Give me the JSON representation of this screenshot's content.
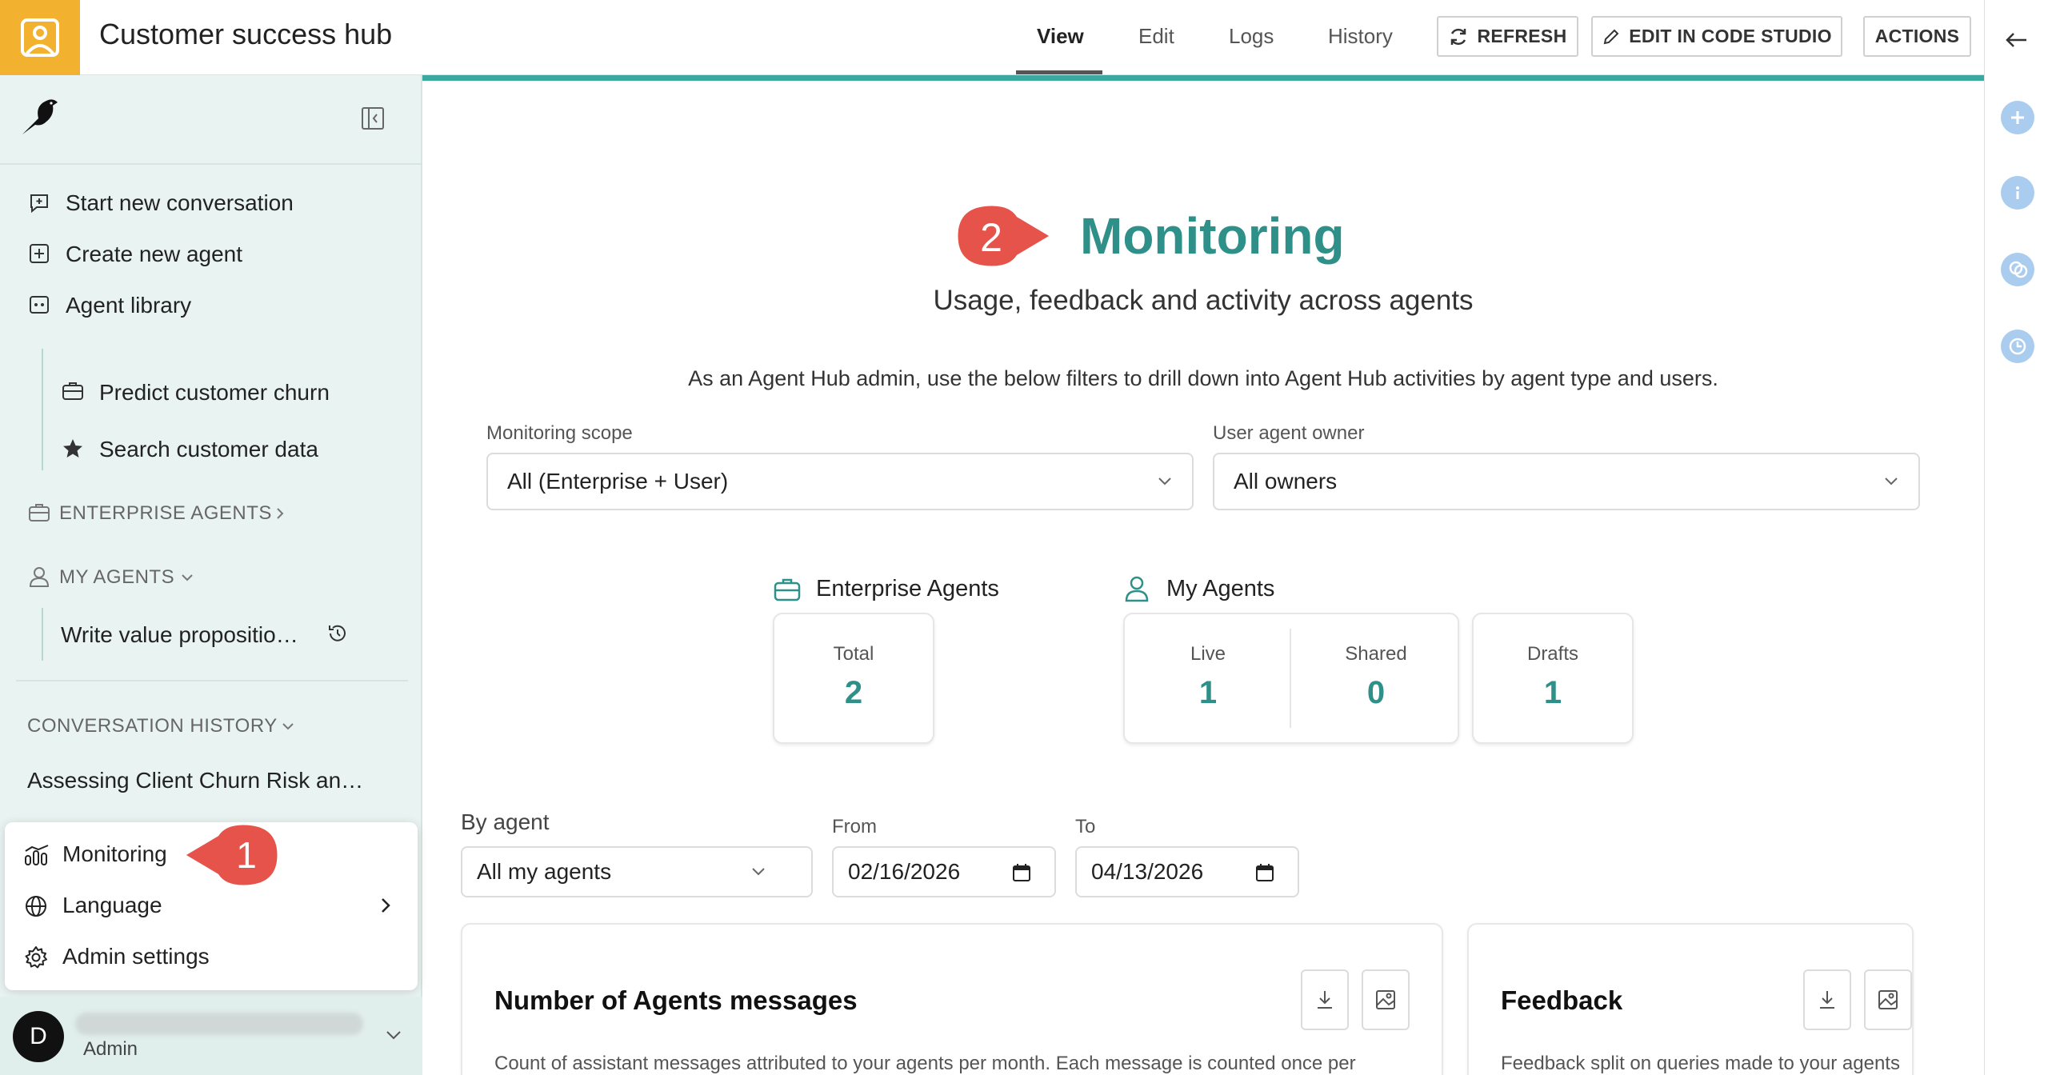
{
  "app": {
    "title": "Customer success hub"
  },
  "tabs": {
    "view": "View",
    "edit": "Edit",
    "logs": "Logs",
    "history": "History"
  },
  "toolbar": {
    "refresh": "REFRESH",
    "edit_code": "EDIT IN CODE STUDIO",
    "actions": "ACTIONS"
  },
  "sidebar": {
    "start_conversation": "Start new conversation",
    "create_agent": "Create new agent",
    "agent_library": "Agent library",
    "pinned": [
      "Predict customer churn",
      "Search customer data"
    ],
    "enterprise_agents": "ENTERPRISE AGENTS",
    "my_agents": "MY AGENTS",
    "my_agent_item": "Write value propositio…",
    "conversation_history": "CONVERSATION HISTORY",
    "conversation_item": "Assessing Client Churn Risk an…"
  },
  "popup": {
    "monitoring": "Monitoring",
    "language": "Language",
    "admin_settings": "Admin settings"
  },
  "user": {
    "avatar_letter": "D",
    "role": "Admin"
  },
  "callouts": {
    "one": "1",
    "two": "2"
  },
  "main": {
    "title": "Monitoring",
    "subtitle": "Usage, feedback and activity across agents",
    "description": "As an Agent Hub admin, use the below filters to drill down into Agent Hub activities by agent type and users.",
    "scope_label": "Monitoring scope",
    "scope_value": "All (Enterprise + User)",
    "owner_label": "User agent owner",
    "owner_value": "All owners",
    "enterprise_head": "Enterprise Agents",
    "my_agents_head": "My Agents",
    "stats": {
      "total_label": "Total",
      "total_value": "2",
      "live_label": "Live",
      "live_value": "1",
      "shared_label": "Shared",
      "shared_value": "0",
      "drafts_label": "Drafts",
      "drafts_value": "1"
    },
    "by_agent_label": "By agent",
    "by_agent_value": "All my agents",
    "from_label": "From",
    "from_value": "02/16/2026",
    "to_label": "To",
    "to_value": "04/13/2026",
    "panel1_title": "Number of Agents messages",
    "panel1_desc": "Count of assistant messages attributed to your agents per month. Each message is counted once per",
    "panel2_title": "Feedback",
    "panel2_desc": "Feedback split on queries made to your agents"
  },
  "colors": {
    "accent": "#2f8f89",
    "app_icon_bg": "#f2b12f",
    "callout": "#e5534b",
    "sidebar_bg": "#e9f3f1"
  }
}
